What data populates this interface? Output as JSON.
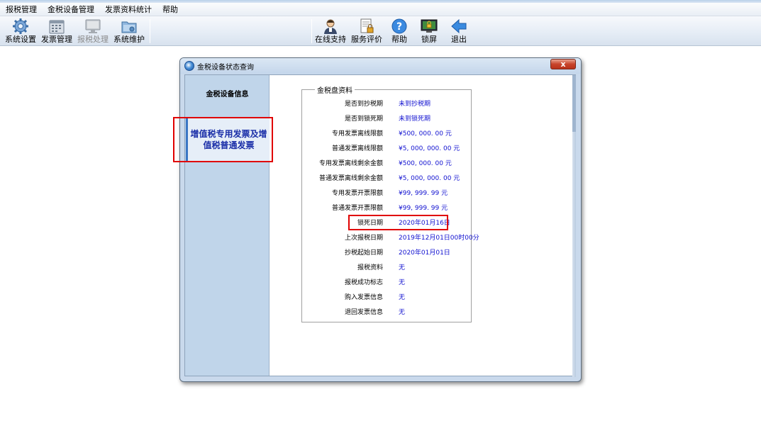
{
  "menu": [
    "报税管理",
    "金税设备管理",
    "发票资料统计",
    "帮助"
  ],
  "toolbar": {
    "left": [
      {
        "label": "系统设置",
        "icon": "gear-icon",
        "disabled": false
      },
      {
        "label": "发票管理",
        "icon": "calendar-icon",
        "disabled": false
      },
      {
        "label": "报税处理",
        "icon": "monitor-icon",
        "disabled": true
      },
      {
        "label": "系统维护",
        "icon": "folder-icon",
        "disabled": false
      }
    ],
    "right": [
      {
        "label": "在线支持",
        "icon": "support-person-icon"
      },
      {
        "label": "服务评价",
        "icon": "document-lock-icon"
      },
      {
        "label": "帮助",
        "icon": "help-icon"
      },
      {
        "label": "锁屏",
        "icon": "lock-screen-icon"
      },
      {
        "label": "退出",
        "icon": "exit-arrow-icon"
      }
    ]
  },
  "dialog": {
    "title": "金税设备状态查询",
    "close": "x",
    "sidebar": {
      "item1": "金税设备信息",
      "item2": "增值税专用发票及增值税普通发票"
    },
    "group": {
      "legend": "金税盘资料",
      "rows": [
        {
          "key": "是否到抄税期",
          "value": "未到抄税期"
        },
        {
          "key": "是否到锁死期",
          "value": "未到锁死期"
        },
        {
          "key": "专用发票离线限额",
          "value": "¥500, 000. 00 元"
        },
        {
          "key": "普通发票离线限额",
          "value": "¥5, 000, 000. 00 元"
        },
        {
          "key": "专用发票离线剩余金额",
          "value": "¥500, 000. 00 元"
        },
        {
          "key": "普通发票离线剩余金额",
          "value": "¥5, 000, 000. 00 元"
        },
        {
          "key": "专用发票开票限额",
          "value": "¥99, 999. 99 元"
        },
        {
          "key": "普通发票开票限额",
          "value": "¥99, 999. 99 元"
        },
        {
          "key": "锁死日期",
          "value": "2020年01月16日"
        },
        {
          "key": "上次报税日期",
          "value": "2019年12月01日00时00分"
        },
        {
          "key": "抄税起始日期",
          "value": "2020年01月01日"
        },
        {
          "key": "报税资料",
          "value": "无"
        },
        {
          "key": "报税成功标志",
          "value": "无"
        },
        {
          "key": "购入发票信息",
          "value": "无"
        },
        {
          "key": "退回发票信息",
          "value": "无"
        }
      ]
    }
  },
  "colors": {
    "highlight": "#e00000",
    "value_text": "#1010d0",
    "sidebar_bg": "#c0d5ea",
    "selected_text": "#1a2ea8"
  }
}
